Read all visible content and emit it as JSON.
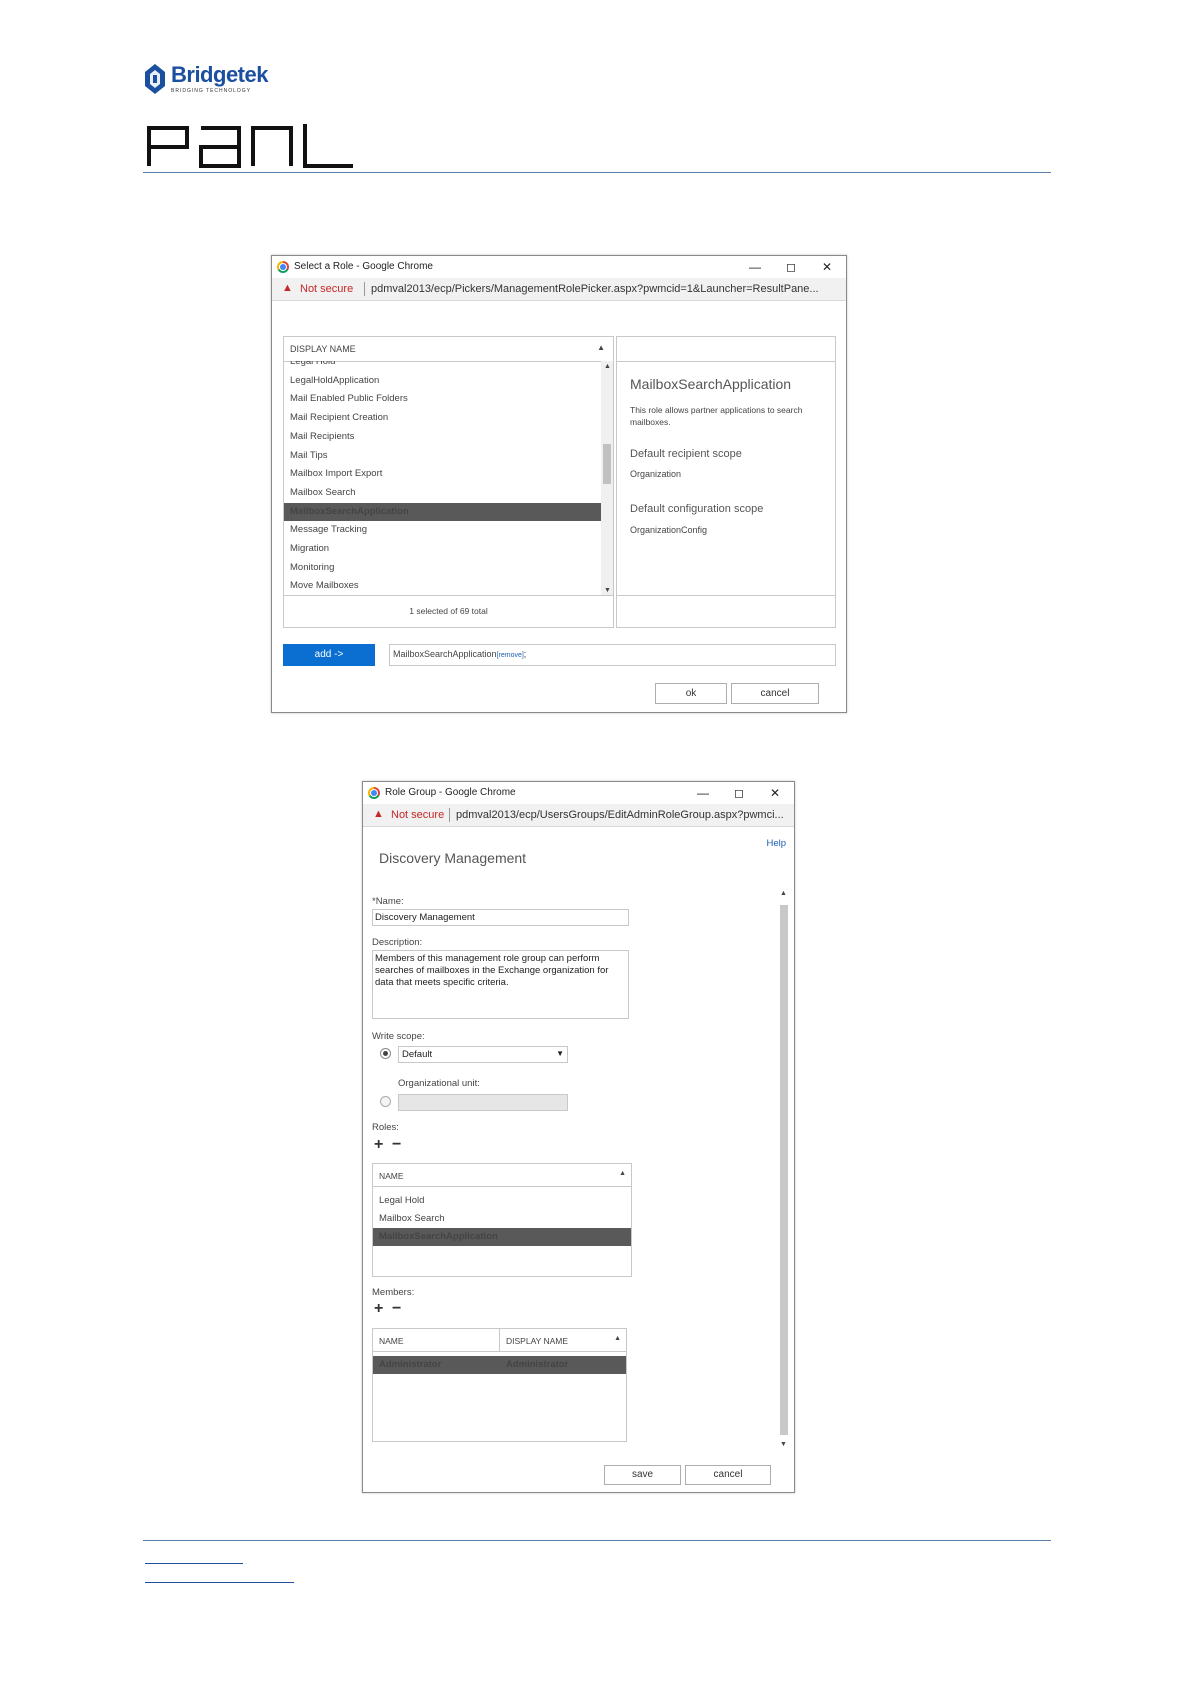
{
  "header": {
    "brand": "Bridgetek",
    "tagline": "BRIDGING TECHNOLOGY",
    "product": "PANL"
  },
  "picker_window": {
    "title": "Select a Role - Google Chrome",
    "not_secure": "Not secure",
    "url": "pdmval2013/ecp/Pickers/ManagementRolePicker.aspx?pwmcid=1&Launcher=ResultPane...",
    "column_header": "DISPLAY NAME",
    "items": [
      "Legal Hold",
      "LegalHoldApplication",
      "Mail Enabled Public Folders",
      "Mail Recipient Creation",
      "Mail Recipients",
      "Mail Tips",
      "Mailbox Import Export",
      "Mailbox Search",
      "MailboxSearchApplication",
      "Message Tracking",
      "Migration",
      "Monitoring",
      "Move Mailboxes"
    ],
    "selected_index": 8,
    "status": "1 selected of 69 total",
    "details": {
      "title": "MailboxSearchApplication",
      "description": "This role allows partner applications to search mailboxes.",
      "recipient_scope_label": "Default recipient scope",
      "recipient_scope_value": "Organization",
      "config_scope_label": "Default configuration scope",
      "config_scope_value": "OrganizationConfig"
    },
    "add_button": "add ->",
    "added_value": "MailboxSearchApplication",
    "remove_link": "[remove]",
    "added_suffix": ";",
    "ok_button": "ok",
    "cancel_button": "cancel"
  },
  "rolegroup_window": {
    "title": "Role Group - Google Chrome",
    "not_secure": "Not secure",
    "url": "pdmval2013/ecp/UsersGroups/EditAdminRoleGroup.aspx?pwmci...",
    "help": "Help",
    "heading": "Discovery Management",
    "name_label": "*Name:",
    "name_value": "Discovery Management",
    "description_label": "Description:",
    "description_value": "Members of this management role group can perform searches of mailboxes in the Exchange organization for data that meets specific criteria.",
    "write_scope_label": "Write scope:",
    "write_scope_value": "Default",
    "org_unit_label": "Organizational unit:",
    "roles_label": "Roles:",
    "roles_header": "NAME",
    "roles": [
      "Legal Hold",
      "Mailbox Search",
      "MailboxSearchApplication"
    ],
    "roles_selected_index": 2,
    "members_label": "Members:",
    "members_headers": [
      "NAME",
      "DISPLAY NAME"
    ],
    "members": [
      {
        "name": "Administrator",
        "display": "Administrator"
      }
    ],
    "save_button": "save",
    "cancel_button": "cancel"
  },
  "colors": {
    "rule": "#5a7ea6",
    "selection": "#595959",
    "primary_button": "#0a6fd0",
    "warning": "#c62828",
    "link": "#1f4e9e"
  }
}
